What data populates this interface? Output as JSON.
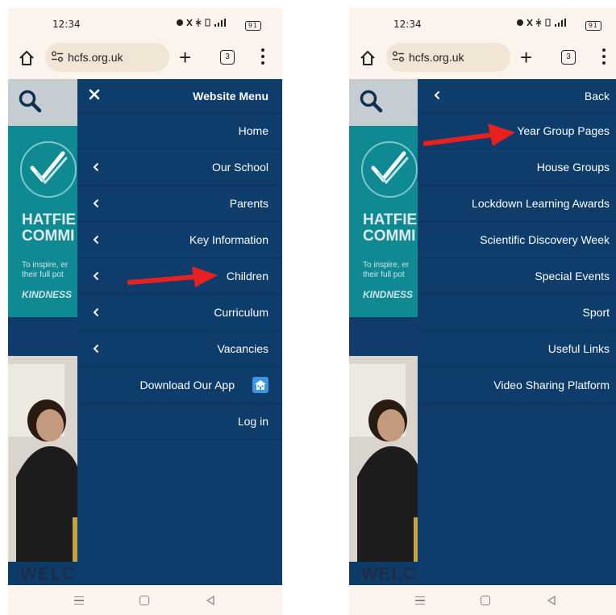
{
  "colors": {
    "menu_bg": "#0e3c6b",
    "hero_teal": "#0f8a93",
    "arrow_red": "#e8201e",
    "app_badge": "#3b98e0",
    "browser_bg": "#fbf4ec"
  },
  "status_bar": {
    "time": "12:34",
    "left_icons": "◍ ∘",
    "right_icons": "⏰ ☄ ✳ ▓ ᵀᴸ▐",
    "battery": "91"
  },
  "browser": {
    "url": "hcfs.org.uk",
    "tab_count": "3",
    "new_tab_label": "+"
  },
  "site": {
    "hero_title_line1": "HATFIE",
    "hero_title_line2": "COMMI",
    "hero_sub_line1": "To inspire, er",
    "hero_sub_line2": "their full pot",
    "hero_motto": "KINDNESS",
    "welcome_partial": "WELC"
  },
  "screen1": {
    "menu_title": "Website Menu",
    "items": [
      {
        "label": "Home",
        "chevron": false
      },
      {
        "label": "Our School",
        "chevron": true
      },
      {
        "label": "Parents",
        "chevron": true
      },
      {
        "label": "Key Information",
        "chevron": true
      },
      {
        "label": "Children",
        "chevron": true
      },
      {
        "label": "Curriculum",
        "chevron": true
      },
      {
        "label": "Vacancies",
        "chevron": true
      },
      {
        "label": "Download Our App",
        "chevron": false
      },
      {
        "label": "Log in",
        "chevron": false
      }
    ]
  },
  "screen2": {
    "back_label": "Back",
    "items": [
      {
        "label": "Year Group Pages"
      },
      {
        "label": "House Groups"
      },
      {
        "label": "Lockdown Learning Awards"
      },
      {
        "label": "Scientific Discovery Week"
      },
      {
        "label": "Special Events"
      },
      {
        "label": "Sport"
      },
      {
        "label": "Useful Links"
      },
      {
        "label": "Video Sharing Platform"
      }
    ]
  }
}
